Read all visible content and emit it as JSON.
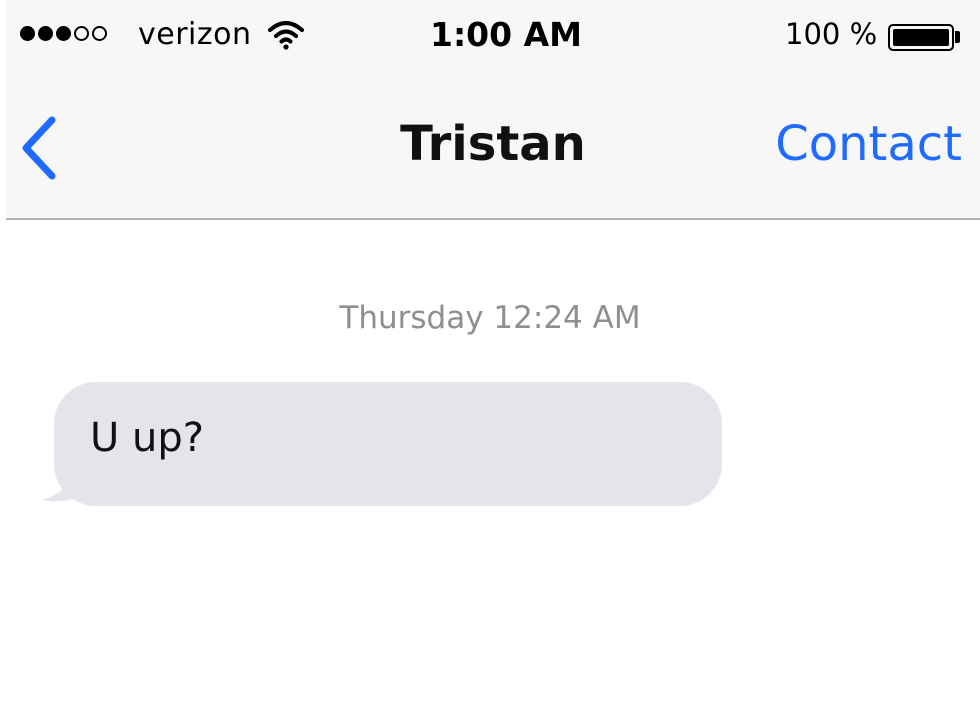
{
  "status_bar": {
    "signal_bars_filled": 3,
    "signal_bars_total": 5,
    "carrier": "verizon",
    "time": "1:00 AM",
    "battery_percent": "100 %",
    "battery_level": 1.0,
    "wifi_icon": "wifi-icon"
  },
  "nav": {
    "back_icon": "chevron-left-icon",
    "title": "Tristan",
    "contact_label": "Contact"
  },
  "conversation": {
    "timestamp": "Thursday 12:24 AM",
    "messages": [
      {
        "direction": "incoming",
        "text": "U up?"
      }
    ]
  },
  "colors": {
    "accent": "#1f6bff",
    "bubble_incoming": "#e5e4ea",
    "timestamp": "#8e8e93",
    "nav_background": "#f7f7f7"
  }
}
